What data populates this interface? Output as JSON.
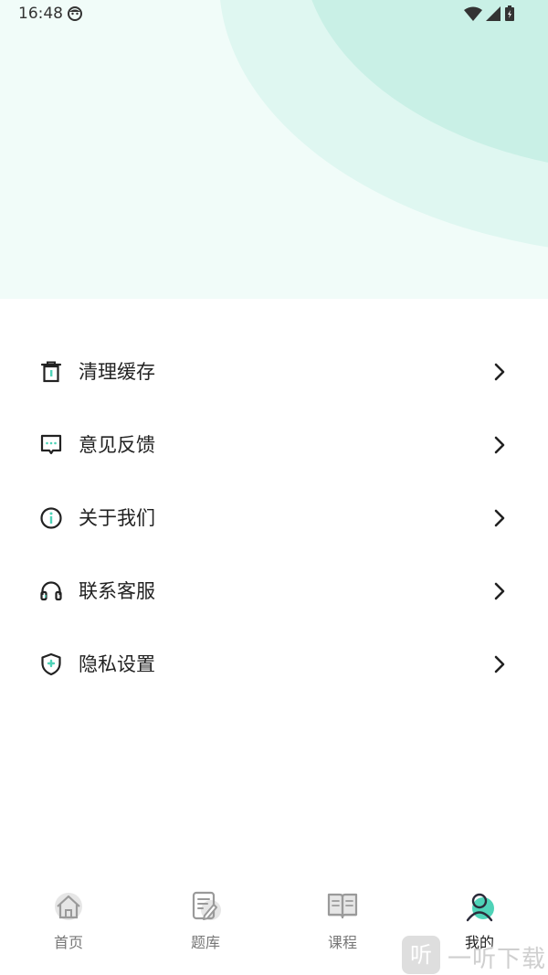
{
  "status": {
    "time": "16:48"
  },
  "menu": {
    "items": [
      {
        "label": "清理缓存",
        "icon": "trash-icon"
      },
      {
        "label": "意见反馈",
        "icon": "feedback-icon"
      },
      {
        "label": "关于我们",
        "icon": "info-icon"
      },
      {
        "label": "联系客服",
        "icon": "headset-icon"
      },
      {
        "label": "隐私设置",
        "icon": "shield-icon"
      }
    ]
  },
  "tabbar": {
    "tabs": [
      {
        "label": "首页",
        "icon": "home-icon"
      },
      {
        "label": "题库",
        "icon": "question-bank-icon"
      },
      {
        "label": "课程",
        "icon": "book-icon"
      },
      {
        "label": "我的",
        "icon": "profile-icon",
        "active": true
      }
    ]
  },
  "watermark": {
    "badge": "听",
    "text": "一听下载"
  },
  "colors": {
    "accent": "#4fd3b8",
    "hero_bg": "#f1fcf9",
    "hero_arc1": "#dff7f1",
    "hero_arc2": "#c9f0e6"
  }
}
